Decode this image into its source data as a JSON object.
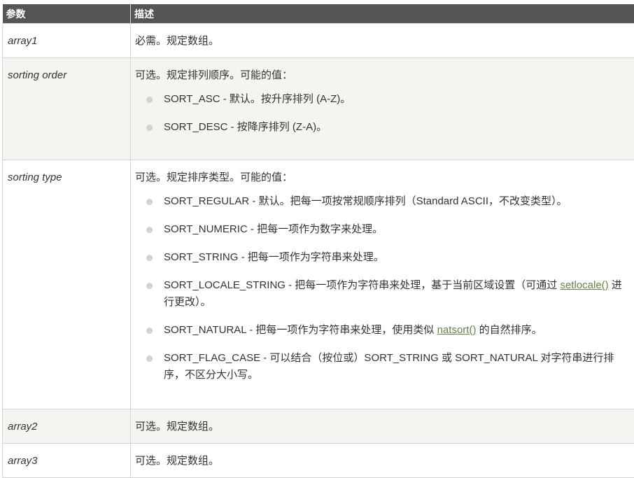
{
  "table": {
    "headers": {
      "param": "参数",
      "desc": "描述"
    },
    "rows": [
      {
        "param": "array1",
        "desc": "必需。规定数组。"
      },
      {
        "param": "sorting order",
        "desc": "可选。规定排列顺序。可能的值：",
        "items": [
          "SORT_ASC - 默认。按升序排列 (A-Z)。",
          "SORT_DESC - 按降序排列 (Z-A)。"
        ]
      },
      {
        "param": "sorting type",
        "desc": "可选。规定排序类型。可能的值：",
        "items": [
          "SORT_REGULAR - 默认。把每一项按常规顺序排列（Standard ASCII，不改变类型）。",
          "SORT_NUMERIC - 把每一项作为数字来处理。",
          "SORT_STRING - 把每一项作为字符串来处理。",
          {
            "before": "SORT_LOCALE_STRING - 把每一项作为字符串来处理，基于当前区域设置（可通过 ",
            "link": "setlocale()",
            "after": " 进行更改）。"
          },
          {
            "before": "SORT_NATURAL - 把每一项作为字符串来处理，使用类似 ",
            "link": "natsort()",
            "after": " 的自然排序。"
          },
          "SORT_FLAG_CASE - 可以结合（按位或）SORT_STRING 或 SORT_NATURAL 对字符串进行排序，不区分大小写。"
        ]
      },
      {
        "param": "array2",
        "desc": "可选。规定数组。"
      },
      {
        "param": "array3",
        "desc": "可选。规定数组。"
      }
    ]
  }
}
